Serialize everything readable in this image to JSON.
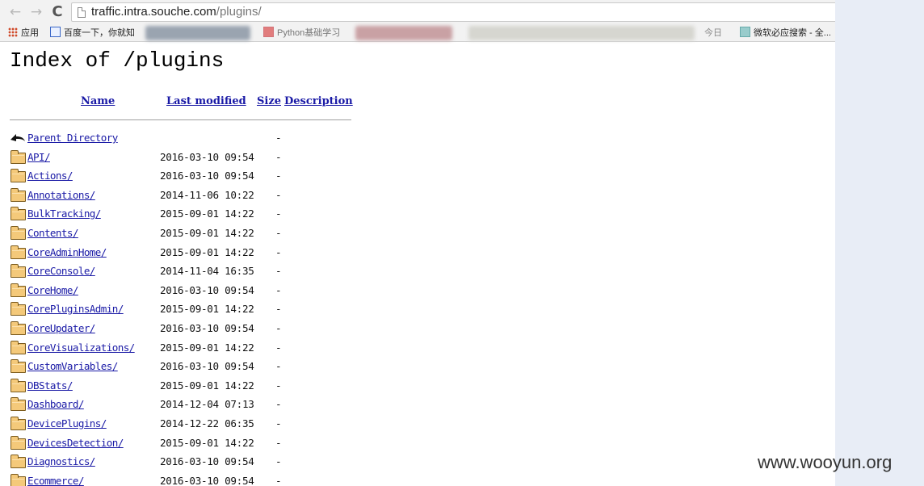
{
  "browser": {
    "back_glyph": "←",
    "forward_glyph": "→",
    "reload_glyph": "C",
    "url_host": "traffic.intra.souche.com",
    "url_path": "/plugins/"
  },
  "bookmarks": [
    {
      "label": "应用",
      "icon": "apps-icon"
    },
    {
      "label": "百度一下，你就知",
      "icon": "page-icon"
    },
    {
      "label": "Python基础学习",
      "icon": "page-icon"
    },
    {
      "label": "今日",
      "icon": "page-icon"
    },
    {
      "label": "微软必应搜索 - 全...",
      "icon": "page-icon"
    }
  ],
  "page": {
    "title": "Index of /plugins",
    "columns": {
      "name": "Name",
      "modified": "Last modified",
      "size": "Size",
      "description": "Description"
    },
    "rows": [
      {
        "name": "Parent Directory",
        "modified": "",
        "size": "-",
        "icon": "back-icon"
      },
      {
        "name": "API/",
        "modified": "2016-03-10 09:54",
        "size": "-",
        "icon": "folder-icon"
      },
      {
        "name": "Actions/",
        "modified": "2016-03-10 09:54",
        "size": "-",
        "icon": "folder-icon"
      },
      {
        "name": "Annotations/",
        "modified": "2014-11-06 10:22",
        "size": "-",
        "icon": "folder-icon"
      },
      {
        "name": "BulkTracking/",
        "modified": "2015-09-01 14:22",
        "size": "-",
        "icon": "folder-icon"
      },
      {
        "name": "Contents/",
        "modified": "2015-09-01 14:22",
        "size": "-",
        "icon": "folder-icon"
      },
      {
        "name": "CoreAdminHome/",
        "modified": "2015-09-01 14:22",
        "size": "-",
        "icon": "folder-icon"
      },
      {
        "name": "CoreConsole/",
        "modified": "2014-11-04 16:35",
        "size": "-",
        "icon": "folder-icon"
      },
      {
        "name": "CoreHome/",
        "modified": "2016-03-10 09:54",
        "size": "-",
        "icon": "folder-icon"
      },
      {
        "name": "CorePluginsAdmin/",
        "modified": "2015-09-01 14:22",
        "size": "-",
        "icon": "folder-icon"
      },
      {
        "name": "CoreUpdater/",
        "modified": "2016-03-10 09:54",
        "size": "-",
        "icon": "folder-icon"
      },
      {
        "name": "CoreVisualizations/",
        "modified": "2015-09-01 14:22",
        "size": "-",
        "icon": "folder-icon"
      },
      {
        "name": "CustomVariables/",
        "modified": "2016-03-10 09:54",
        "size": "-",
        "icon": "folder-icon"
      },
      {
        "name": "DBStats/",
        "modified": "2015-09-01 14:22",
        "size": "-",
        "icon": "folder-icon"
      },
      {
        "name": "Dashboard/",
        "modified": "2014-12-04 07:13",
        "size": "-",
        "icon": "folder-icon"
      },
      {
        "name": "DevicePlugins/",
        "modified": "2014-12-22 06:35",
        "size": "-",
        "icon": "folder-icon"
      },
      {
        "name": "DevicesDetection/",
        "modified": "2015-09-01 14:22",
        "size": "-",
        "icon": "folder-icon"
      },
      {
        "name": "Diagnostics/",
        "modified": "2016-03-10 09:54",
        "size": "-",
        "icon": "folder-icon"
      },
      {
        "name": "Ecommerce/",
        "modified": "2016-03-10 09:54",
        "size": "-",
        "icon": "folder-icon"
      }
    ]
  },
  "watermark": "www.wooyun.org"
}
